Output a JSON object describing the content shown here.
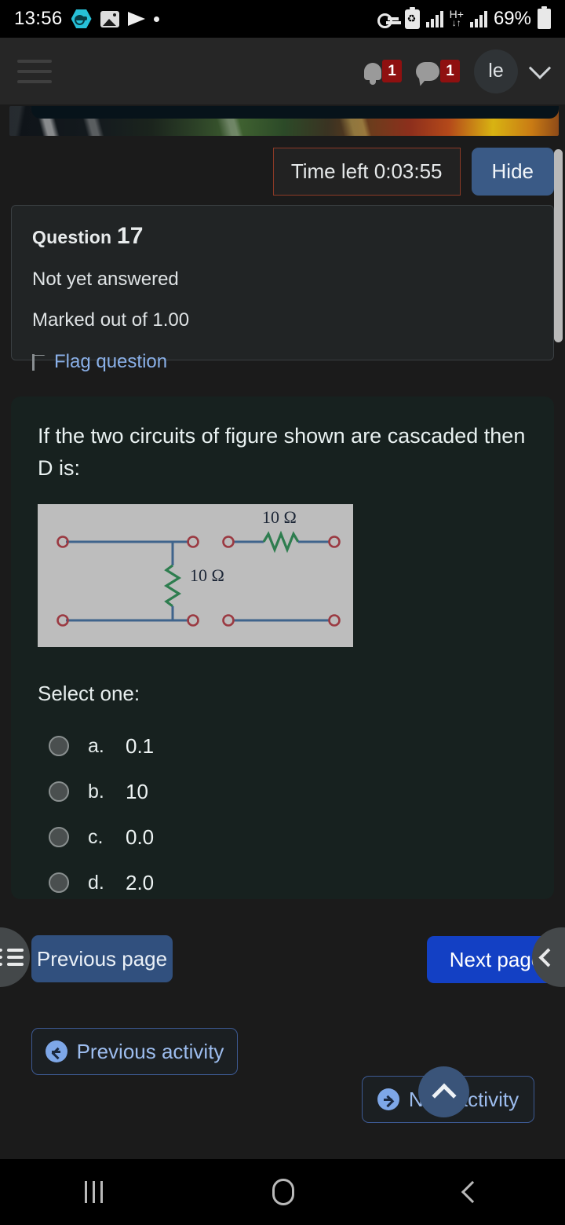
{
  "statusbar": {
    "time": "13:56",
    "left_icons": [
      "vpn-key-icon",
      "gallery-icon",
      "telegram-icon",
      "dot-icon"
    ],
    "right_icons": [
      "key-icon",
      "battery-saver-icon",
      "signal-bars-icon",
      "hplus-network-icon",
      "signal-bars-2-icon",
      "battery-icon"
    ],
    "network_label": "H+",
    "network_arrows": "↓↑",
    "battery_percent": "69%"
  },
  "navbar": {
    "menu_icon": "hamburger-icon",
    "notifications": {
      "icon": "bell-icon",
      "count": "1"
    },
    "messages": {
      "icon": "chat-icon",
      "count": "1"
    },
    "avatar_initials": "le",
    "dropdown_icon": "chevron-down-icon"
  },
  "quiz": {
    "timer_label": "Time left 0:03:55",
    "hide_label": "Hide",
    "question_number_label": "Question",
    "question_number": "17",
    "status": "Not yet answered",
    "marks": "Marked out of 1.00",
    "flag_label": "Flag question",
    "question_text": "If the two circuits of figure shown are cascaded then D is:",
    "select_label": "Select one:",
    "figure": {
      "left_circuit_label": "10 Ω",
      "right_circuit_label": "10 Ω"
    },
    "options": [
      {
        "letter": "a.",
        "value": "0.1",
        "selected": false
      },
      {
        "letter": "b.",
        "value": "10",
        "selected": false
      },
      {
        "letter": "c.",
        "value": "0.0",
        "selected": false
      },
      {
        "letter": "d.",
        "value": "2.0",
        "selected": false
      }
    ],
    "prev_page_label": "Previous page",
    "next_page_label": "Next page"
  },
  "activity_nav": {
    "previous_label": "Previous activity",
    "next_label": "Next activity",
    "scroll_top_icon": "chevron-up-icon"
  },
  "drawer_handles": {
    "left_icon": "list-icon",
    "right_icon": "chevron-left-icon"
  },
  "androidnav": {
    "recents_icon": "recents-icon",
    "home_icon": "home-icon",
    "back_icon": "back-icon"
  },
  "colors": {
    "page_bg": "#1b1b1b",
    "card_bg": "#17211f",
    "accent_blue": "#1340c4",
    "muted_blue": "#31507e",
    "timer_border": "#8d3a26",
    "link_blue": "#8ab0e8",
    "badge_red": "#8f1010",
    "figure_bg": "#bdbdbd",
    "wire": "#3f648c",
    "resistor": "#2e7d4f",
    "terminal": "#9b3a42"
  }
}
